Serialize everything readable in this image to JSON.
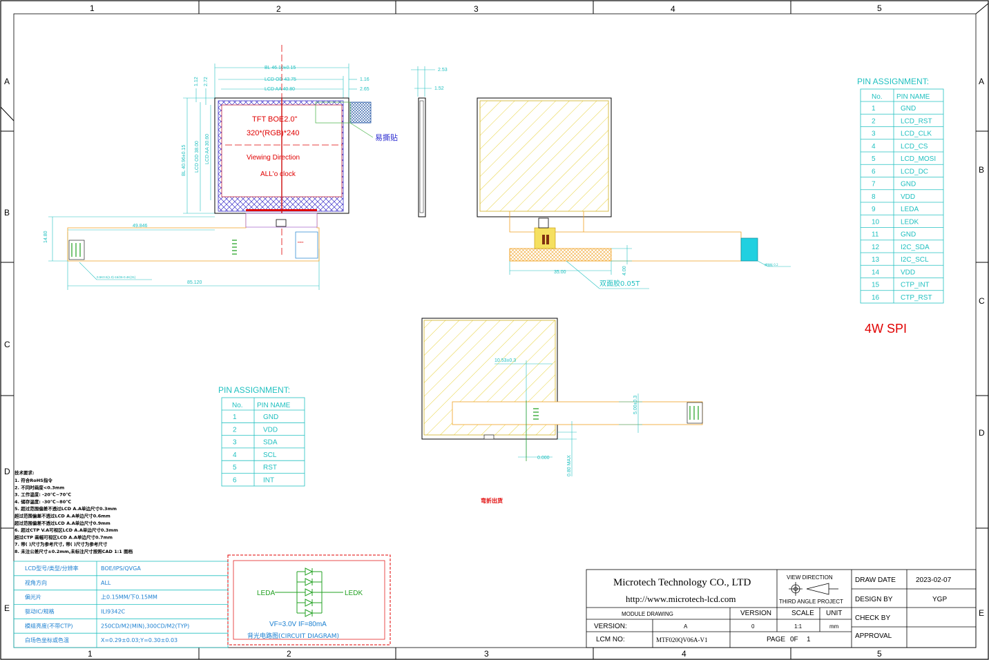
{
  "frame": {
    "columns": [
      "1",
      "2",
      "3",
      "4",
      "5"
    ],
    "rows": [
      "A",
      "B",
      "C",
      "D",
      "E"
    ]
  },
  "front_view": {
    "dims": {
      "bl_w": "BL 46.10±0.15",
      "od_w": "LCD OD 43.75",
      "aa_w": "LCD AA 40.80",
      "d116": "1.16",
      "d265": "2.65",
      "d112": "1.12",
      "d272": "2.72",
      "bl_h": "BL 40.96±0.15",
      "od_h": "LCD OD 38.00",
      "aa_h": "LCD AA 30.60",
      "fpc_x": "49.846",
      "fpc_h": "14.80",
      "total_w": "85.120",
      "connector_note": "0.5K0.5(1.0)-16/26-0.4K(31)"
    },
    "label_title": "TFT BOE2.0\"",
    "label_res": "320*(RGB)*240",
    "label_view": "Viewing Direction",
    "label_clock": "ALL'o clock",
    "tape_label": "易撕贴"
  },
  "side_view": {
    "d253": "2.53",
    "d152": "1.52"
  },
  "back_view": {
    "d35": "35.00",
    "d4": "4.00",
    "tape": "双面胶0.05T",
    "stiffener": "補強板 0.2"
  },
  "bottom_view": {
    "d1053": "10.53±0.3",
    "d500": "5.00±0.3",
    "d0": "0.000",
    "d08": "0.80 MAX",
    "fold_note": "弯折出货"
  },
  "pin_table_right": {
    "title": "PIN ASSIGNMENT:",
    "headers": [
      "No.",
      "PIN NAME"
    ],
    "rows": [
      [
        "1",
        "GND"
      ],
      [
        "2",
        "LCD_RST"
      ],
      [
        "3",
        "LCD_CLK"
      ],
      [
        "4",
        "LCD_CS"
      ],
      [
        "5",
        "LCD_MOSI"
      ],
      [
        "6",
        "LCD_DC"
      ],
      [
        "7",
        "GND"
      ],
      [
        "8",
        "VDD"
      ],
      [
        "9",
        "LEDA"
      ],
      [
        "10",
        "LEDK"
      ],
      [
        "11",
        "GND"
      ],
      [
        "12",
        "I2C_SDA"
      ],
      [
        "13",
        "I2C_SCL"
      ],
      [
        "14",
        "VDD"
      ],
      [
        "15",
        "CTP_INT"
      ],
      [
        "16",
        "CTP_RST"
      ]
    ],
    "interface": "4W SPI"
  },
  "pin_table_left": {
    "title": "PIN ASSIGNMENT:",
    "headers": [
      "No.",
      "PIN NAME"
    ],
    "rows": [
      [
        "1",
        "GND"
      ],
      [
        "2",
        "VDD"
      ],
      [
        "3",
        "SDA"
      ],
      [
        "4",
        "SCL"
      ],
      [
        "5",
        "RST"
      ],
      [
        "6",
        "INT"
      ]
    ]
  },
  "notes": {
    "title": "技术要求:",
    "lines": [
      "1. 符合RoHS指令",
      "2. 不同时画度<0.3mm",
      "3. 工作温度: -20℃~70℃",
      "4. 储存温度: -30℃~80℃",
      "5. 超过范围偏差不透过LCD A.A单边尺寸0.3mm",
      "   超过范围偏差不透过LCD A.A单边尺寸0.6mm",
      "   超过范围偏差不透过LCD A.A单边尺寸0.9mm",
      "6. 超过CTP V.A可视区LCD A.A单边尺寸0.3mm",
      "   超过CTP 画幅可视区LCD A.A单边尺寸0.7mm",
      "7. 带( )尺寸为参考尺寸, 带( )尺寸为参考尺寸",
      "8. 未注公差尺寸±0.2mm,未标注尺寸按照CAD 1:1 图档"
    ]
  },
  "spec_table": {
    "rows": [
      [
        "LCD型号/类型/分辨率",
        "BOE/IPS/QVGA"
      ],
      [
        "视角方向",
        "ALL"
      ],
      [
        "偏光片",
        "上0.15MM/下0.15MM"
      ],
      [
        "驱动IC/规格",
        "ILI9342C"
      ],
      [
        "模组亮度(不带CTP)",
        "250CD/M2(MIN),300CD/M2(TYP)"
      ],
      [
        "白场色坐标或色温",
        "X=0.29±0.03;Y=0.30±0.03"
      ]
    ]
  },
  "circuit": {
    "leda": "LEDA",
    "ledk": "LEDK",
    "params": "VF=3.0V  IF=80mA",
    "caption": "背光电路图(CIRCUIT DIAGRAM)"
  },
  "title_block": {
    "company": "Microtech Technology CO., LTD",
    "url": "http://www.microtech-lcd.com",
    "view_direction": "VIEW DIRECTION",
    "projection": "THIRD ANGLE PROJECT",
    "module_drawing": "MODULE DRAWING",
    "version_h": "VERSION",
    "scale_h": "SCALE",
    "unit_h": "UNIT",
    "version_label": "VERSION:",
    "version_val": "A",
    "version_num": "0",
    "scale_val": "1:1",
    "unit_val": "mm",
    "lcm_label": "LCM NO:",
    "lcm_val": "MTF020QV06A-V1",
    "page": "PAGE",
    "page_n": "0F",
    "page_total": "1",
    "draw_date_label": "DRAW DATE",
    "draw_date": "2023-02-07",
    "design_label": "DESIGN BY",
    "design_val": "YGP",
    "check_label": "CHECK BY",
    "approval_label": "APPROVAL"
  }
}
